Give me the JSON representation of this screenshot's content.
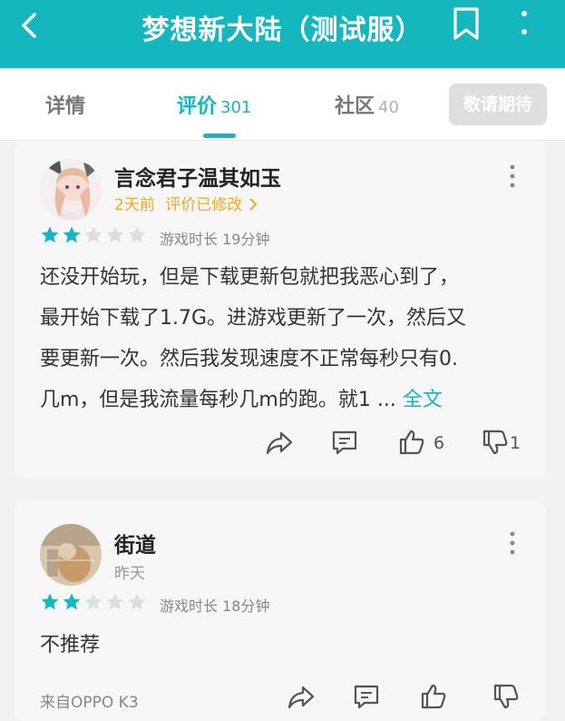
{
  "header": {
    "title": "梦想新大陆（测试服）"
  },
  "tabs": [
    {
      "label": "详情",
      "count": ""
    },
    {
      "label": "评价",
      "count": "301"
    },
    {
      "label": "社区",
      "count": "40"
    }
  ],
  "expect_button": "敬请期待",
  "reviews": [
    {
      "username": "言念君子温其如玉",
      "time": "2天前",
      "edited": "评价已修改",
      "rating": 2,
      "playtime": "游戏时长 19分钟",
      "lines": [
        "还没开始玩，但是下载更新包就把我恶心到了，",
        "最开始下载了1.7G。进游戏更新了一次，然后又",
        "要更新一次。然后我发现速度不正常每秒只有0.",
        "几m，但是我流量每秒几m的跑。就1 ... "
      ],
      "full_text_link": "全文",
      "likes": "6",
      "dislikes": "1"
    },
    {
      "username": "街道",
      "time": "昨天",
      "rating": 2,
      "playtime": "游戏时长 18分钟",
      "text": "不推荐",
      "device": "来自OPPO K3"
    }
  ],
  "colors": {
    "accent": "#15b7be",
    "star_on": "#15b7be",
    "star_off": "#dddddd",
    "edited": "#f5a623"
  }
}
